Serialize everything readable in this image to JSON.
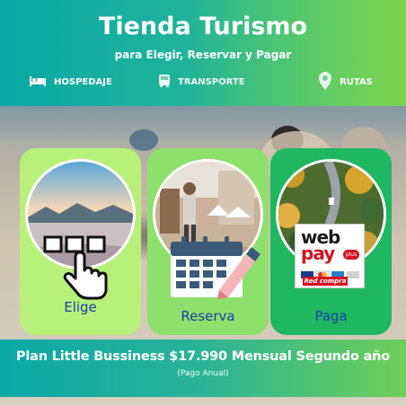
{
  "header": {
    "title": "Tienda Turismo",
    "subtitle": "para Elegir, Reservar y Pagar"
  },
  "nav": {
    "items": [
      {
        "label": "HOSPEDAJE",
        "icon": "bed-icon"
      },
      {
        "label": "TRANSPORTE",
        "icon": "bus-icon"
      },
      {
        "label": "RUTAS",
        "icon": "map-pin-icon"
      }
    ]
  },
  "cards": [
    {
      "label": "Elige",
      "color": "#b7f17a",
      "icon": "hand-pointer-icon"
    },
    {
      "label": "Reserva",
      "color": "#8ee06c",
      "icon": "calendar-icon"
    },
    {
      "label": "Paga",
      "color": "#1fb860",
      "icon": "webpay-logo"
    }
  ],
  "webpay": {
    "web": "web",
    "pay": "pay",
    "plus": "plus",
    "red": "Red compra"
  },
  "plan": {
    "text": "Plan Little Bussiness $17.990 Mensual Segundo año",
    "note": "(Pago Anual)"
  },
  "colors": {
    "label_text": "#1b3fa6",
    "header_start": "#0aa8a6",
    "header_end": "#7fd44f"
  }
}
